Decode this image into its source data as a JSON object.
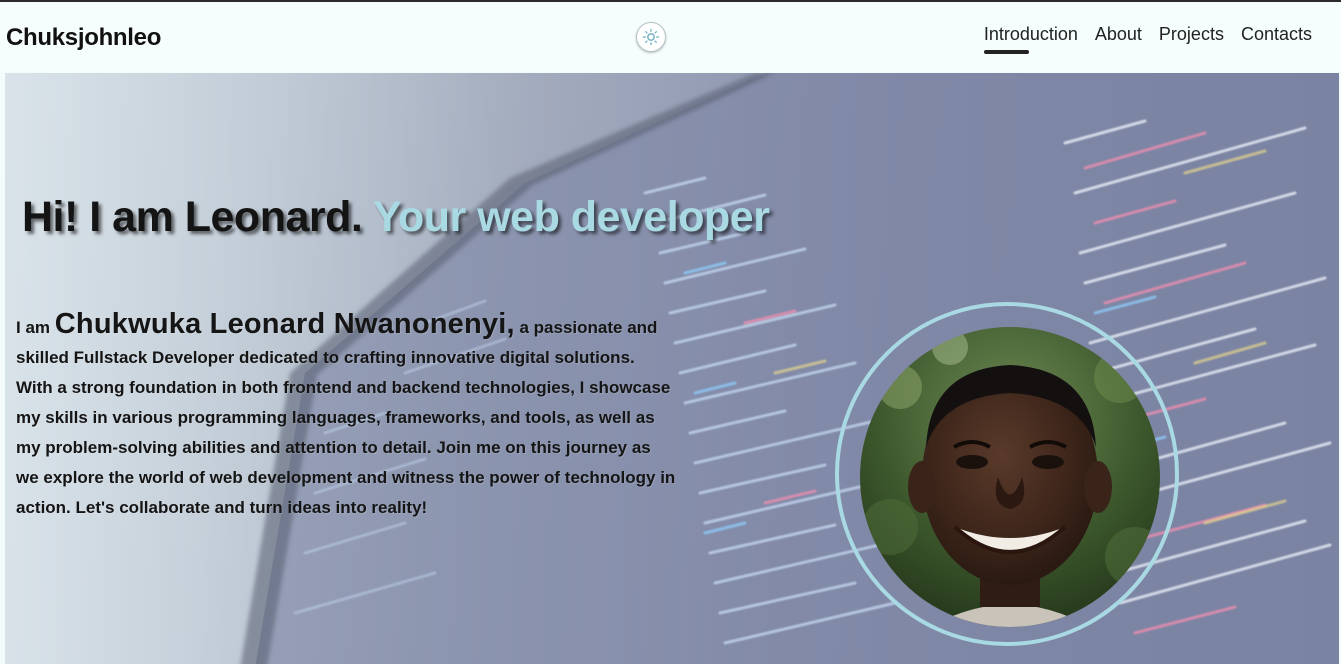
{
  "header": {
    "brand": "Chuksjohnleo",
    "theme_toggle_icon": "sun-icon",
    "nav": [
      {
        "label": "Introduction",
        "active": true
      },
      {
        "label": "About",
        "active": false
      },
      {
        "label": "Projects",
        "active": false
      },
      {
        "label": "Contacts",
        "active": false
      }
    ]
  },
  "hero": {
    "title_main": "Hi! I am Leonard.",
    "title_accent": "Your web developer",
    "intro_prefix": "I am",
    "intro_name": "Chukwuka Leonard Nwanonenyi,",
    "intro_body": " a passionate and skilled Fullstack Developer dedicated to crafting innovative digital solutions. With a strong foundation in both frontend and backend technologies, I showcase my skills in various programming languages, frameworks, and tools, as well as my problem-solving abilities and attention to detail. Join me on this journey as we explore the world of web development and witness the power of technology in action. Let's collaborate and turn ideas into reality!",
    "accent_color": "#a9d9e2"
  }
}
